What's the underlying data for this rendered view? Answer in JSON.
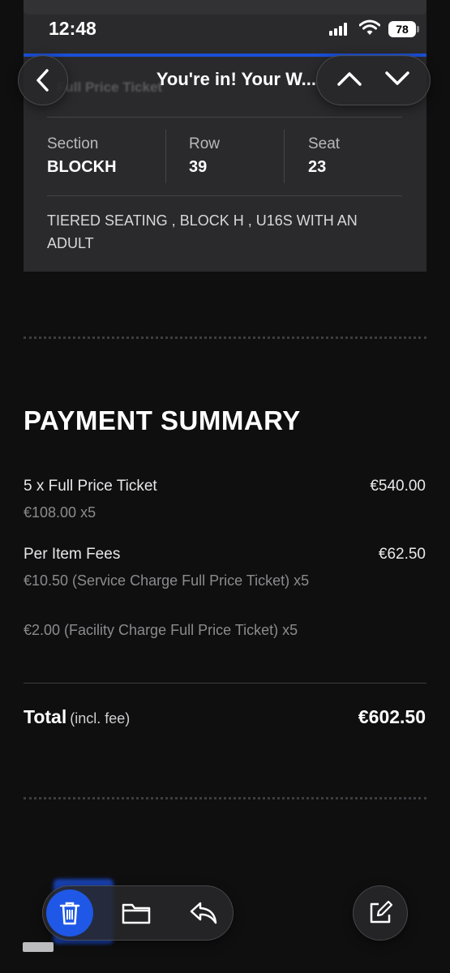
{
  "status_bar": {
    "time": "12:48",
    "battery": "78"
  },
  "nav": {
    "title": "You're in! Your W...",
    "ghost_title": "Full Price Ticket"
  },
  "ticket": {
    "columns": [
      {
        "label": "Section",
        "value": "BLOCKH"
      },
      {
        "label": "Row",
        "value": "39"
      },
      {
        "label": "Seat",
        "value": "23"
      }
    ],
    "note": "TIERED SEATING , BLOCK H , U16S WITH AN ADULT"
  },
  "payment": {
    "title": "PAYMENT SUMMARY",
    "lines": [
      {
        "label": "5 x Full Price Ticket",
        "amount": "€540.00",
        "details": [
          "€108.00 x5"
        ]
      },
      {
        "label": "Per Item Fees",
        "amount": "€62.50",
        "details": [
          "€10.50 (Service Charge Full Price Ticket) x5",
          "€2.00 (Facility Charge Full Price Ticket) x5"
        ]
      }
    ],
    "total_label": "Total",
    "total_note": "(incl. fee)",
    "total_amount": "€602.50"
  },
  "icons": {
    "back": "chevron-left-icon",
    "up": "chevron-up-icon",
    "down": "chevron-down-icon",
    "trash": "trash-icon",
    "folder": "folder-icon",
    "reply": "reply-icon",
    "compose": "compose-icon"
  },
  "colors": {
    "accent_blue": "#1f58e6",
    "background": "#0f0f10",
    "card": "#2a2a2c"
  }
}
